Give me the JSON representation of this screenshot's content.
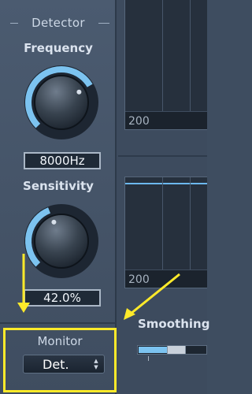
{
  "detector": {
    "title": "Detector",
    "frequency": {
      "label": "Frequency",
      "value": "8000Hz",
      "knob_level": 0.72
    },
    "sensitivity": {
      "label": "Sensitivity",
      "value": "42.0%",
      "knob_level": 0.42
    }
  },
  "monitor": {
    "label": "Monitor",
    "selected": "Det.",
    "icon": "updown-arrows-icon"
  },
  "graphs": {
    "top": {
      "axis_label": "200"
    },
    "bottom": {
      "axis_label": "200"
    }
  },
  "smoothing": {
    "label": "Smoothing",
    "level": 0.55
  },
  "colors": {
    "accent": "#7cc3f0",
    "highlight": "#ffea2a"
  }
}
